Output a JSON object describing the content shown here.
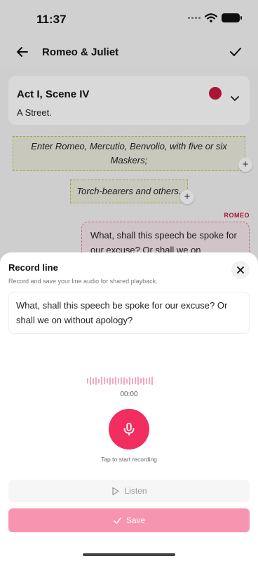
{
  "status_bar": {
    "time": "11:37"
  },
  "nav": {
    "title": "Romeo & Juliet"
  },
  "scene": {
    "title": "Act I, Scene IV",
    "location": "A Street.",
    "dot_color": "#c8183f"
  },
  "directions": [
    {
      "text": "Enter Romeo, Mercutio, Benvolio, with five or six Maskers;"
    },
    {
      "text": "Torch-bearers and others."
    }
  ],
  "dialogue": {
    "character": "ROMEO",
    "preview": "What, shall this speech be spoke for our excuse? Or shall we on"
  },
  "sheet": {
    "title": "Record line",
    "subtitle": "Record and save your line audio for shared playback.",
    "line_text": "What, shall this speech be spoke for our excuse? Or shall we on without apology?",
    "timer": "00:00",
    "hint": "Tap to start recording",
    "listen_label": "Listen",
    "save_label": "Save"
  },
  "colors": {
    "accent": "#f22d5f",
    "save_disabled": "#f794b0",
    "waveform": "#f3a7bf"
  },
  "icons": {
    "back": "arrow-left-icon",
    "check": "check-icon",
    "chevron": "chevron-down-icon",
    "close": "close-icon",
    "mic": "microphone-icon",
    "play": "play-icon",
    "save": "check-icon"
  }
}
